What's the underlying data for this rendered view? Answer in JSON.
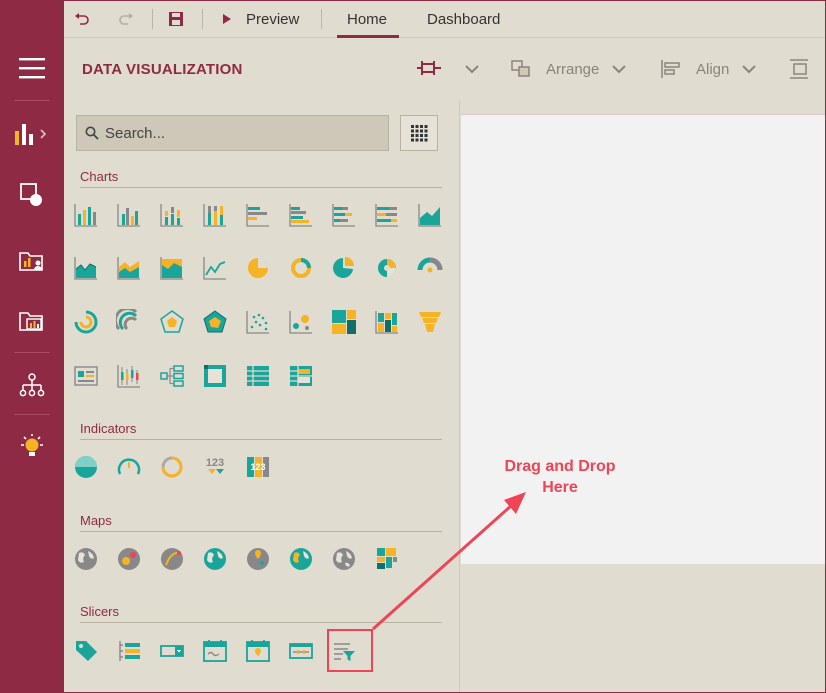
{
  "toolbar": {
    "preview_label": "Preview",
    "tabs": [
      {
        "label": "Home"
      },
      {
        "label": "Dashboard"
      }
    ]
  },
  "panel": {
    "title": "DATA VISUALIZATION",
    "arrange_label": "Arrange",
    "align_label": "Align",
    "search_placeholder": "Search..."
  },
  "sections": {
    "charts": "Charts",
    "indicators": "Indicators",
    "maps": "Maps",
    "slicers": "Slicers"
  },
  "annotation": {
    "line1": "Drag and Drop",
    "line2": "Here"
  },
  "colors": {
    "brand": "#8e2a43",
    "teal": "#1aa59b",
    "yellow": "#f5b325",
    "gray": "#8a8a8a",
    "annotation_red": "#ee4455"
  }
}
